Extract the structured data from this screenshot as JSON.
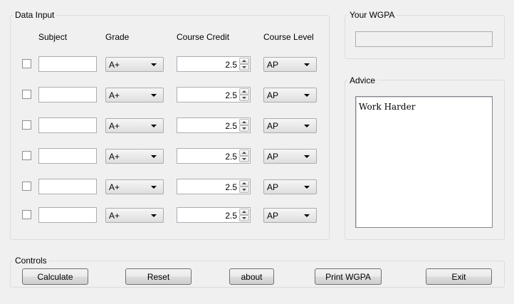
{
  "data_input": {
    "title": "Data Input",
    "headers": {
      "subject": "Subject",
      "grade": "Grade",
      "credit": "Course Credit",
      "level": "Course Level"
    },
    "rows": [
      {
        "subject": "",
        "grade": "A+",
        "credit": "2.5",
        "level": "AP"
      },
      {
        "subject": "",
        "grade": "A+",
        "credit": "2.5",
        "level": "AP"
      },
      {
        "subject": "",
        "grade": "A+",
        "credit": "2.5",
        "level": "AP"
      },
      {
        "subject": "",
        "grade": "A+",
        "credit": "2.5",
        "level": "AP"
      },
      {
        "subject": "",
        "grade": "A+",
        "credit": "2.5",
        "level": "AP"
      },
      {
        "subject": "",
        "grade": "A+",
        "credit": "2.5",
        "level": "AP"
      }
    ]
  },
  "wgpa": {
    "title": "Your WGPA",
    "value": ""
  },
  "advice": {
    "title": "Advice",
    "text": "Work Harder"
  },
  "controls": {
    "title": "Controls",
    "calculate": "Calculate",
    "reset": "Reset",
    "about": "about",
    "print": "Print WGPA",
    "exit": "Exit"
  },
  "icons": {
    "spin_up": "spin-up-arrow-icon",
    "spin_down": "spin-down-arrow-icon",
    "dropdown": "dropdown-arrow-icon"
  }
}
